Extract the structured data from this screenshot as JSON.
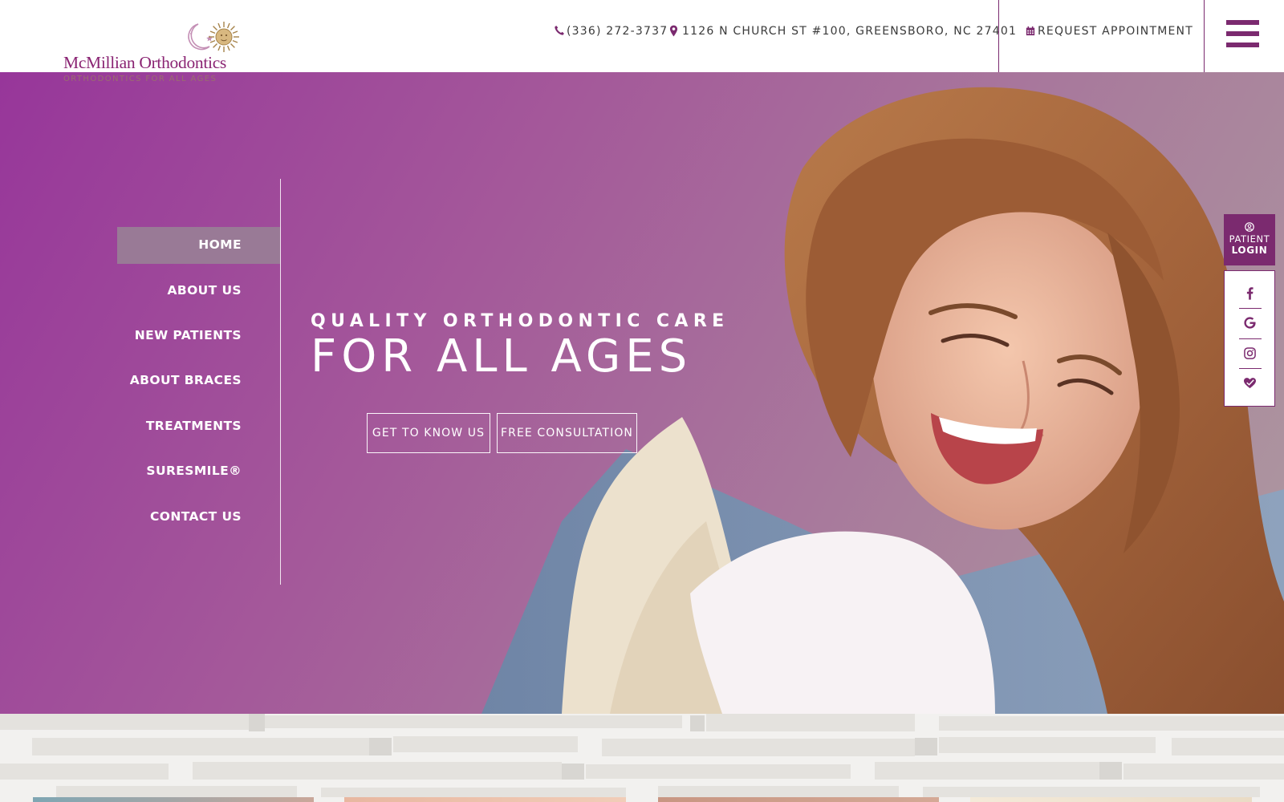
{
  "brand": {
    "name": "McMillian Orthodontics",
    "tagline": "ORTHODONTICS FOR ALL AGES"
  },
  "header": {
    "phone": "(336) 272-3737",
    "address": "1126 N CHURCH ST #100, GREENSBORO, NC 27401",
    "appointment_label": "REQUEST APPOINTMENT",
    "phone_icon": "phone-icon",
    "address_icon": "map-marker-icon",
    "appointment_icon": "calendar-icon",
    "menu_icon": "hamburger-menu-icon"
  },
  "nav": {
    "items": [
      {
        "label": "HOME",
        "active": true
      },
      {
        "label": "ABOUT US",
        "active": false
      },
      {
        "label": "NEW PATIENTS",
        "active": false
      },
      {
        "label": "ABOUT BRACES",
        "active": false
      },
      {
        "label": "TREATMENTS",
        "active": false
      },
      {
        "label": "SURESMILE®",
        "active": false
      },
      {
        "label": "CONTACT US",
        "active": false
      }
    ]
  },
  "hero": {
    "headline_top": "QUALITY ORTHODONTIC CARE",
    "headline_main": "FOR ALL AGES",
    "buttons": {
      "know_us": "GET TO KNOW US",
      "consultation": "FREE CONSULTATION"
    }
  },
  "side": {
    "login_line1": "PATIENT",
    "login_line2": "LOGIN",
    "login_icon": "user-circle-icon",
    "social_icons": [
      "facebook-icon",
      "google-icon",
      "instagram-icon",
      "review-heart-icon"
    ]
  },
  "colors": {
    "brand_purple": "#7b2a6f",
    "hero_gradient_start": "#97369a",
    "hero_gradient_end": "#ad9ba0",
    "nav_active_bg": "#997a96"
  }
}
